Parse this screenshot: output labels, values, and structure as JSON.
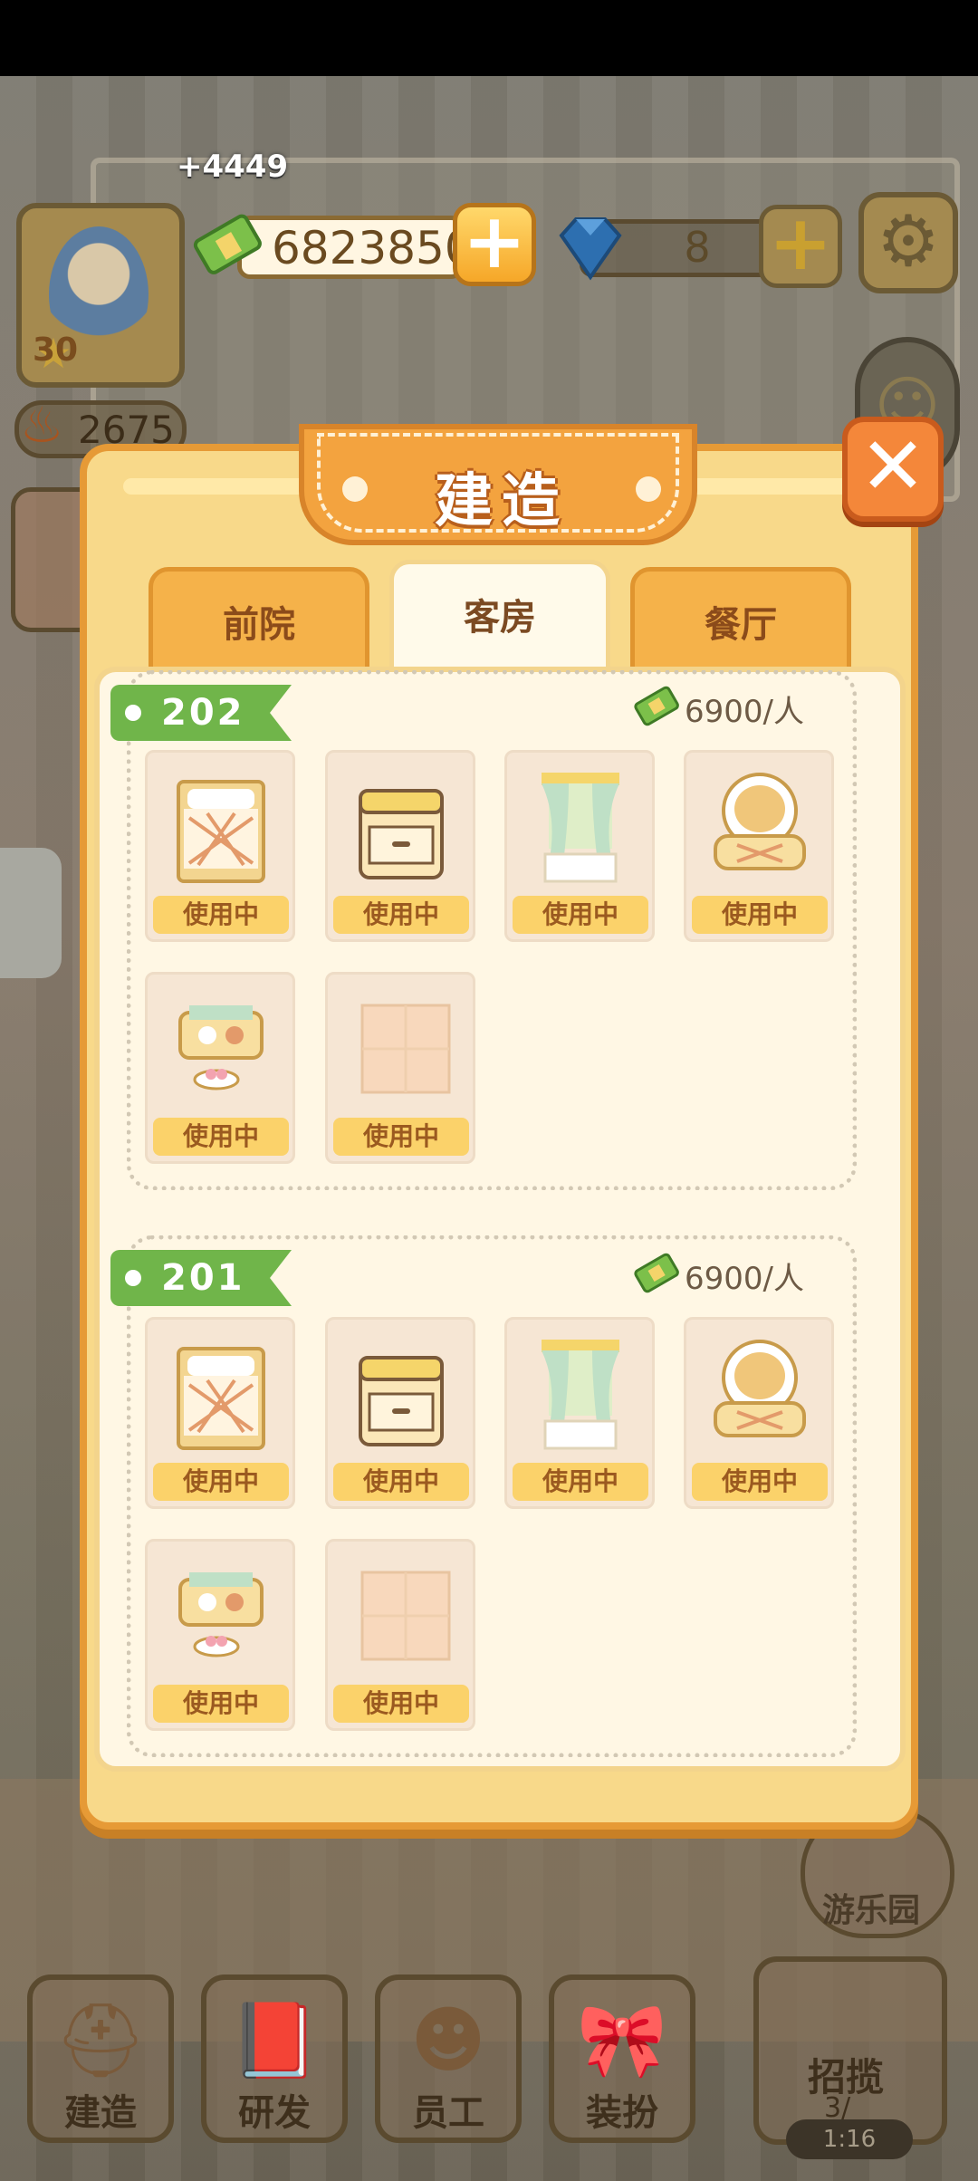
{
  "hud": {
    "income_popup": "+4449",
    "cash": "6823850",
    "gems": "8",
    "level": "30",
    "energy": "2675",
    "plus_symbol": "+"
  },
  "modal": {
    "title": "建造",
    "close_symbol": "✕",
    "tabs": [
      {
        "label": "前院",
        "active": false
      },
      {
        "label": "客房",
        "active": true
      },
      {
        "label": "餐厅",
        "active": false
      }
    ],
    "rooms": [
      {
        "name": "202",
        "price": "6900/人",
        "items": [
          {
            "icon": "bed-icon",
            "status": "使用中"
          },
          {
            "icon": "nightstand-icon",
            "status": "使用中"
          },
          {
            "icon": "window-curtain-icon",
            "status": "使用中"
          },
          {
            "icon": "armchair-icon",
            "status": "使用中"
          },
          {
            "icon": "sofa-table-icon",
            "status": "使用中"
          },
          {
            "icon": "floor-tile-icon",
            "status": "使用中"
          }
        ]
      },
      {
        "name": "201",
        "price": "6900/人",
        "items": [
          {
            "icon": "bed-icon",
            "status": "使用中"
          },
          {
            "icon": "nightstand-icon",
            "status": "使用中"
          },
          {
            "icon": "window-curtain-icon",
            "status": "使用中"
          },
          {
            "icon": "armchair-icon",
            "status": "使用中"
          },
          {
            "icon": "sofa-table-icon",
            "status": "使用中"
          },
          {
            "icon": "floor-tile-icon",
            "status": "使用中"
          }
        ]
      }
    ]
  },
  "side": {
    "park_label": "游乐园"
  },
  "bottom_nav": [
    {
      "label": "建造",
      "icon": "hardhat-icon"
    },
    {
      "label": "研发",
      "icon": "book-icon"
    },
    {
      "label": "员工",
      "icon": "chef-icon"
    },
    {
      "label": "装扮",
      "icon": "bow-icon"
    }
  ],
  "recruit": {
    "label": "招揽",
    "count": "3/",
    "timer": "1:16"
  },
  "colors": {
    "accent_orange": "#f3a33f",
    "ribbon_green": "#70b54a",
    "status_yellow": "#fbd26a",
    "panel_cream": "#fff7e4"
  }
}
